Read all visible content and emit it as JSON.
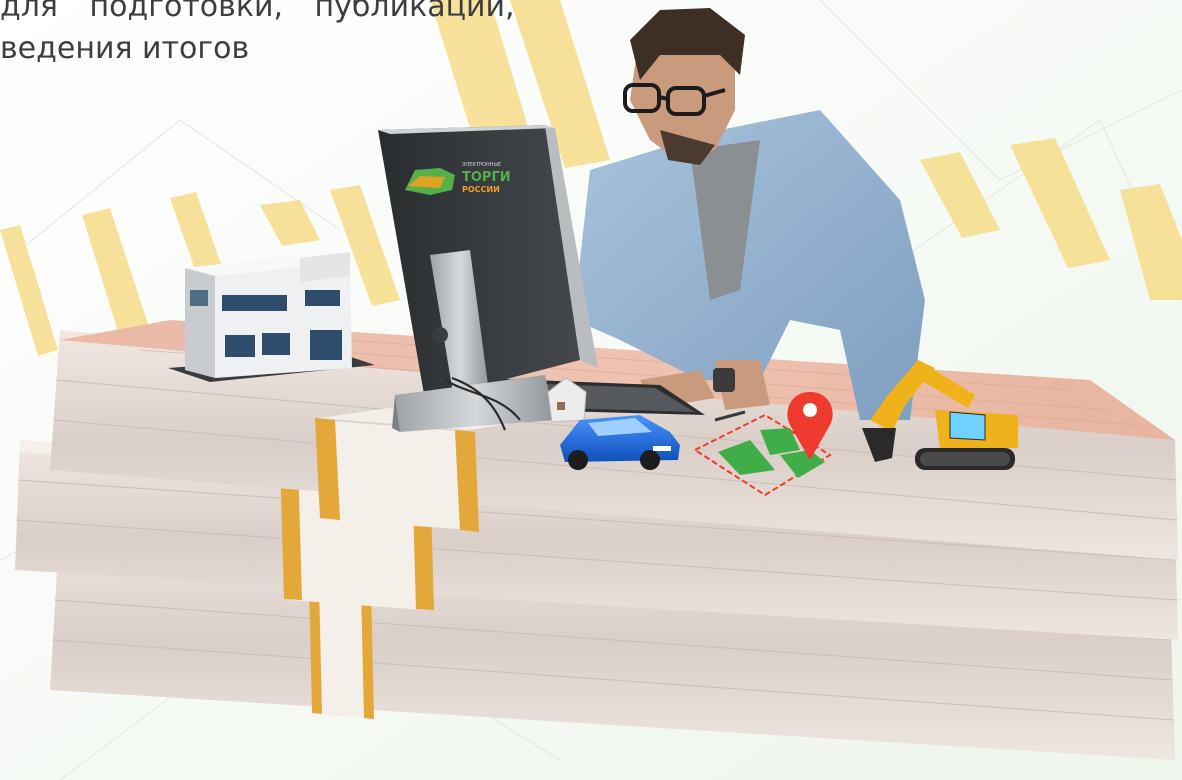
{
  "intro": {
    "line1": "для подготовки, публикации,",
    "line2": "ведения итогов"
  },
  "monitor_logo": {
    "small": "ЭЛЕКТРОННЫЕ",
    "main": "ТОРГИ",
    "sub": "РОССИИ"
  },
  "colors": {
    "accent_yellow": "#f5d46b",
    "brand_green": "#55b047",
    "brand_orange": "#f0a020",
    "banknote": "#e7b7a3",
    "band": "#e3a73a",
    "pin_red": "#ef3b2d",
    "car_blue": "#1f6fe0",
    "excavator_yellow": "#f0b21a"
  }
}
